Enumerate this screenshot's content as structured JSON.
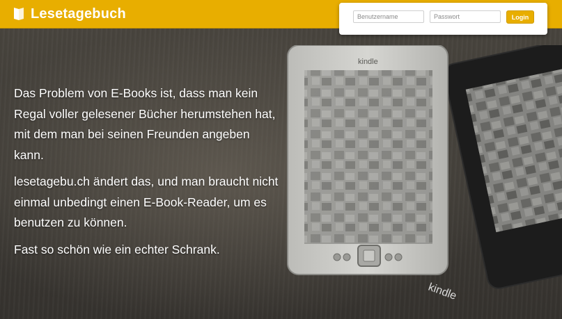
{
  "brand": {
    "name": "Lesetagebuch",
    "icon": "book-icon"
  },
  "login": {
    "username_placeholder": "Benutzername",
    "username_value": "",
    "password_placeholder": "Passwort",
    "password_value": "",
    "button_label": "Login"
  },
  "hero": {
    "paragraphs": [
      "Das Problem von E-Books ist, dass man kein Regal voller gelesener Bücher herumstehen hat, mit dem man bei seinen Freunden angeben kann.",
      "lesetagebu.ch ändert das, und man braucht nicht einmal unbedingt einen E-Book-Reader, um es benutzen zu können.",
      "Fast so schön wie ein echter Schrank."
    ]
  },
  "image": {
    "device_brand_front": "kindle",
    "device_brand_back": "kindle"
  },
  "colors": {
    "accent": "#e8ae00",
    "background": "#3f3c37",
    "text": "#ffffff"
  }
}
